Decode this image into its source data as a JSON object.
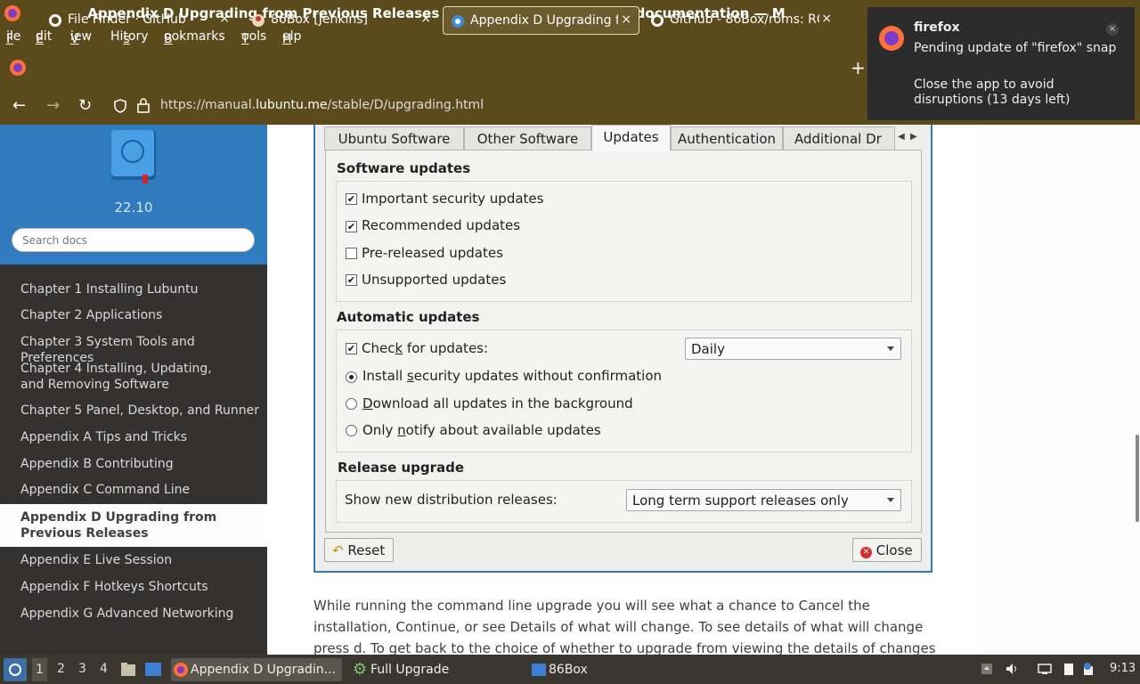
{
  "window": {
    "title": "Appendix D Upgrading from Previous Releases — Lubuntu Manual 22.10 documentation — M"
  },
  "menu": {
    "items": [
      "File",
      "Edit",
      "View",
      "History",
      "Bookmarks",
      "Tools",
      "Help"
    ],
    "mnemonics": [
      "F",
      "E",
      "V",
      "s",
      "B",
      "T",
      "H"
    ]
  },
  "tabs": [
    {
      "label": "File Finder · GitHub",
      "icon": "github-icon",
      "close": "×"
    },
    {
      "label": "86Box [Jenkins]",
      "icon": "jenkins-icon",
      "close": "×"
    },
    {
      "label": "Appendix D Upgrading fr",
      "icon": "lubuntu-icon",
      "close": "×",
      "active": true
    },
    {
      "label": "GitHub - 86Box/roms: RO",
      "icon": "github-icon",
      "close": "×"
    }
  ],
  "new_tab": "+",
  "nav": {
    "url_prefix": "https://manual.",
    "url_domain": "lubuntu.me",
    "url_path": "/stable/D/upgrading.html"
  },
  "notification": {
    "app": "firefox",
    "message": "Pending update of \"firefox\" snap",
    "detail": "Close the app to avoid disruptions (13 days left)",
    "close": "×"
  },
  "sidebar": {
    "version": "22.10",
    "search_placeholder": "Search docs",
    "items": [
      "Chapter 1 Installing Lubuntu",
      "Chapter 2 Applications",
      "Chapter 3 System Tools and Preferences",
      "Chapter 4 Installing, Updating, and Removing Software",
      "Chapter 5 Panel, Desktop, and Runner",
      "Appendix A Tips and Tricks",
      "Appendix B Contributing",
      "Appendix C Command Line",
      "Appendix D Upgrading from Previous Releases",
      "Appendix E Live Session",
      "Appendix F Hotkeys Shortcuts",
      "Appendix G Advanced Networking"
    ],
    "current_index": 8
  },
  "dialog": {
    "tabs": [
      "Ubuntu Software",
      "Other Software",
      "Updates",
      "Authentication",
      "Additional Dr"
    ],
    "active_tab": "Updates",
    "software_updates": {
      "heading": "Software updates",
      "options": [
        {
          "label": "Important security updates",
          "checked": true
        },
        {
          "label": "Recommended updates",
          "checked": true
        },
        {
          "label": "Pre-released updates",
          "checked": false
        },
        {
          "label": "Unsupported updates",
          "checked": true
        }
      ]
    },
    "automatic_updates": {
      "heading": "Automatic updates",
      "check_label_pre": "Chec",
      "check_label_mn": "k",
      "check_label_post": " for updates:",
      "check_checked": true,
      "frequency": "Daily",
      "radio_1_pre": "Install ",
      "radio_1_mn": "s",
      "radio_1_post": "ecurity updates without confirmation",
      "radio_2_mn": "D",
      "radio_2_post": "ownload all updates in the background",
      "radio_3_pre": "Only ",
      "radio_3_mn": "n",
      "radio_3_post": "otify about available updates",
      "selected_radio": 1
    },
    "release_upgrade": {
      "heading": "Release upgrade",
      "label": "Show new distribution releases:",
      "value": "Long term support releases only"
    },
    "reset_button": "Reset",
    "close_button": "Close"
  },
  "paragraph": "While running the command line upgrade you will see what a chance to Cancel the installation, Continue, or see Details of what will change. To see details of what will change press d. To get back to the choice of whether to upgrade from viewing the details of changes press q. To cancel the",
  "taskbar": {
    "workspaces": [
      "1",
      "2",
      "3",
      "4"
    ],
    "active_workspace": "1",
    "tasks": [
      {
        "label": "Appendix D Upgradin...",
        "icon": "firefox-icon",
        "active": true
      },
      {
        "label": "Full Upgrade",
        "icon": "gear-icon",
        "active": false
      },
      {
        "label": "86Box",
        "icon": "window-icon",
        "active": false
      }
    ],
    "clock": "9:13"
  },
  "colors": {
    "browser_chrome": "#5b4a1c",
    "sidebar_top": "#2f7bbd",
    "sidebar_nav": "#343131",
    "taskbar": "#3a3630"
  }
}
